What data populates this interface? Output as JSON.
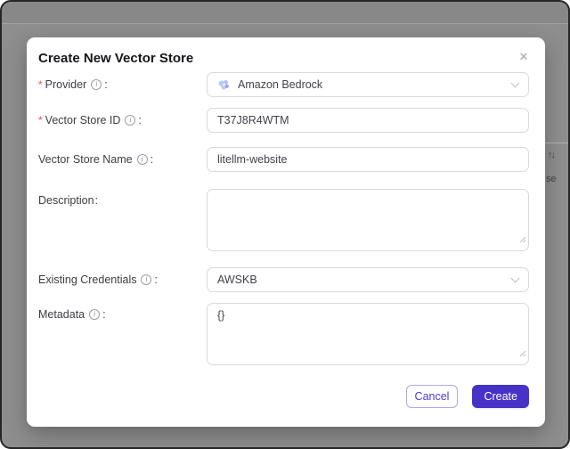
{
  "background_page": {
    "sort_icon": "↑↓",
    "partial_text": "se"
  },
  "modal": {
    "title": "Create New Vector Store",
    "colon": ":",
    "required_marker": "*",
    "fields": [
      {
        "label": "Provider",
        "required": true,
        "info": true,
        "type": "select",
        "value": "Amazon Bedrock"
      },
      {
        "label": "Vector Store ID",
        "required": true,
        "info": true,
        "type": "input",
        "value": "T37J8R4WTM"
      },
      {
        "label": "Vector Store Name",
        "required": false,
        "info": true,
        "type": "input",
        "value": "litellm-website"
      },
      {
        "label": "Description",
        "required": false,
        "info": false,
        "type": "textarea",
        "value": ""
      },
      {
        "label": "Existing Credentials",
        "required": false,
        "info": true,
        "type": "select",
        "value": "AWSKB"
      },
      {
        "label": "Metadata",
        "required": false,
        "info": true,
        "type": "textarea",
        "value": "{}"
      }
    ],
    "footer": {
      "cancel": "Cancel",
      "create": "Create"
    }
  },
  "icons": {
    "close": "✕",
    "info": "i",
    "sort": "↑↓"
  },
  "colors": {
    "primary": "#4732c8",
    "primary_border": "#b3a7f0",
    "required": "#ff4d4f",
    "overlay": "#8e8e8e",
    "input_border": "#d9d9d9"
  }
}
